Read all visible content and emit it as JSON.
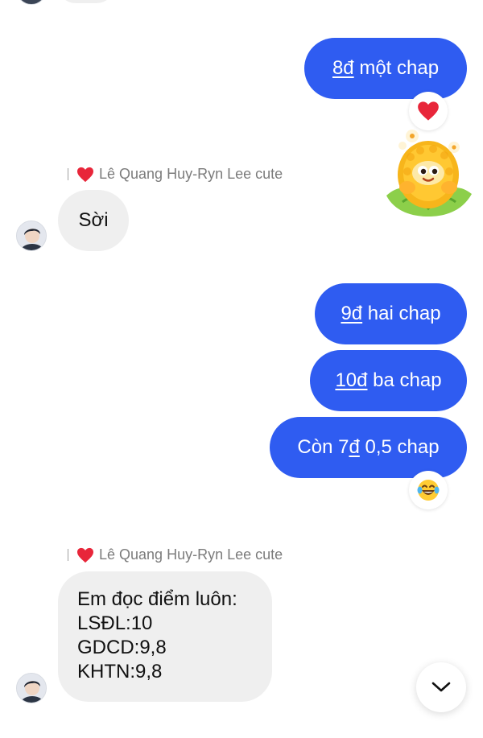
{
  "thread": {
    "sender_name": "Lê Quang Huy-Ryn Lee cute",
    "messages_out": [
      {
        "amount": "8đ",
        "suffix": " một chap"
      },
      {
        "amount": "9đ",
        "suffix": " hai chap"
      },
      {
        "amount": "10đ",
        "suffix": " ba chap"
      },
      {
        "prefix": "Còn 7",
        "amount": "đ",
        "suffix": " 0,5 chap"
      }
    ],
    "messages_in": [
      {
        "text": "Sời"
      },
      {
        "lines": [
          "Em đọc điểm luôn:",
          "LSĐL:10",
          "GDCD:9,8",
          "KHTN:9,8"
        ]
      }
    ]
  },
  "icons": {
    "reaction_1": "red-heart-icon",
    "reaction_2": "laughing-tears-icon",
    "sticker": "corn-sticker",
    "scroll": "chevron-down-icon"
  },
  "colors": {
    "outgoing_bubble": "#2f5cf1",
    "incoming_bubble": "#efefef",
    "heart": "#e8263a"
  }
}
